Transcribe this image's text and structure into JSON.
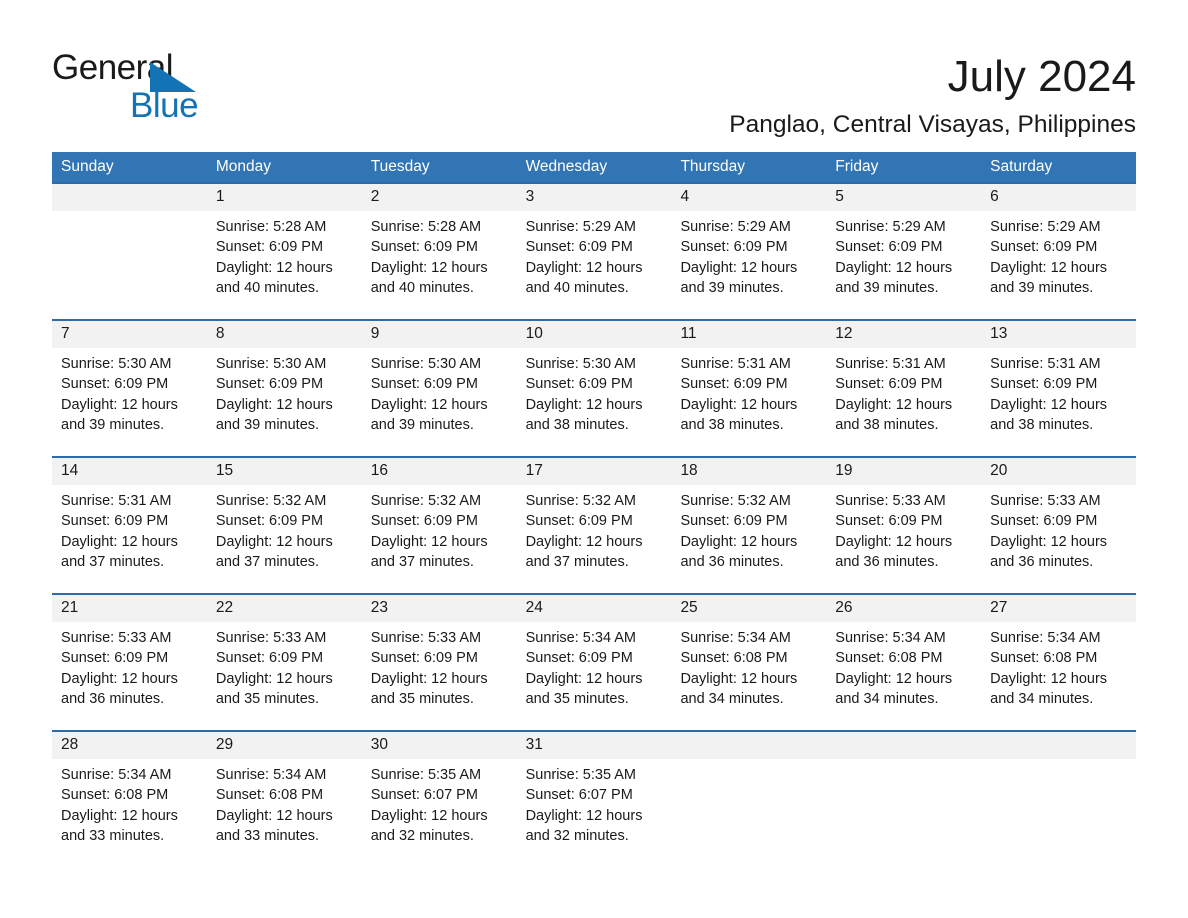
{
  "logo": {
    "word_one": "General",
    "word_two": "Blue",
    "triangle_color": "#1473b5",
    "text_color": "#1a1a1a"
  },
  "header": {
    "title": "July 2024",
    "location": "Panglao, Central Visayas, Philippines"
  },
  "calendar": {
    "header_bg": "#3275b4",
    "header_text_color": "#ffffff",
    "row_border_color": "#2d6ca8",
    "daynum_band_color": "#f2f2f2",
    "weekdays": [
      "Sunday",
      "Monday",
      "Tuesday",
      "Wednesday",
      "Thursday",
      "Friday",
      "Saturday"
    ],
    "weeks": [
      [
        {
          "day": "",
          "sunrise": "",
          "sunset": "",
          "daylight_line1": "",
          "daylight_line2": ""
        },
        {
          "day": "1",
          "sunrise": "Sunrise: 5:28 AM",
          "sunset": "Sunset: 6:09 PM",
          "daylight_line1": "Daylight: 12 hours",
          "daylight_line2": "and 40 minutes."
        },
        {
          "day": "2",
          "sunrise": "Sunrise: 5:28 AM",
          "sunset": "Sunset: 6:09 PM",
          "daylight_line1": "Daylight: 12 hours",
          "daylight_line2": "and 40 minutes."
        },
        {
          "day": "3",
          "sunrise": "Sunrise: 5:29 AM",
          "sunset": "Sunset: 6:09 PM",
          "daylight_line1": "Daylight: 12 hours",
          "daylight_line2": "and 40 minutes."
        },
        {
          "day": "4",
          "sunrise": "Sunrise: 5:29 AM",
          "sunset": "Sunset: 6:09 PM",
          "daylight_line1": "Daylight: 12 hours",
          "daylight_line2": "and 39 minutes."
        },
        {
          "day": "5",
          "sunrise": "Sunrise: 5:29 AM",
          "sunset": "Sunset: 6:09 PM",
          "daylight_line1": "Daylight: 12 hours",
          "daylight_line2": "and 39 minutes."
        },
        {
          "day": "6",
          "sunrise": "Sunrise: 5:29 AM",
          "sunset": "Sunset: 6:09 PM",
          "daylight_line1": "Daylight: 12 hours",
          "daylight_line2": "and 39 minutes."
        }
      ],
      [
        {
          "day": "7",
          "sunrise": "Sunrise: 5:30 AM",
          "sunset": "Sunset: 6:09 PM",
          "daylight_line1": "Daylight: 12 hours",
          "daylight_line2": "and 39 minutes."
        },
        {
          "day": "8",
          "sunrise": "Sunrise: 5:30 AM",
          "sunset": "Sunset: 6:09 PM",
          "daylight_line1": "Daylight: 12 hours",
          "daylight_line2": "and 39 minutes."
        },
        {
          "day": "9",
          "sunrise": "Sunrise: 5:30 AM",
          "sunset": "Sunset: 6:09 PM",
          "daylight_line1": "Daylight: 12 hours",
          "daylight_line2": "and 39 minutes."
        },
        {
          "day": "10",
          "sunrise": "Sunrise: 5:30 AM",
          "sunset": "Sunset: 6:09 PM",
          "daylight_line1": "Daylight: 12 hours",
          "daylight_line2": "and 38 minutes."
        },
        {
          "day": "11",
          "sunrise": "Sunrise: 5:31 AM",
          "sunset": "Sunset: 6:09 PM",
          "daylight_line1": "Daylight: 12 hours",
          "daylight_line2": "and 38 minutes."
        },
        {
          "day": "12",
          "sunrise": "Sunrise: 5:31 AM",
          "sunset": "Sunset: 6:09 PM",
          "daylight_line1": "Daylight: 12 hours",
          "daylight_line2": "and 38 minutes."
        },
        {
          "day": "13",
          "sunrise": "Sunrise: 5:31 AM",
          "sunset": "Sunset: 6:09 PM",
          "daylight_line1": "Daylight: 12 hours",
          "daylight_line2": "and 38 minutes."
        }
      ],
      [
        {
          "day": "14",
          "sunrise": "Sunrise: 5:31 AM",
          "sunset": "Sunset: 6:09 PM",
          "daylight_line1": "Daylight: 12 hours",
          "daylight_line2": "and 37 minutes."
        },
        {
          "day": "15",
          "sunrise": "Sunrise: 5:32 AM",
          "sunset": "Sunset: 6:09 PM",
          "daylight_line1": "Daylight: 12 hours",
          "daylight_line2": "and 37 minutes."
        },
        {
          "day": "16",
          "sunrise": "Sunrise: 5:32 AM",
          "sunset": "Sunset: 6:09 PM",
          "daylight_line1": "Daylight: 12 hours",
          "daylight_line2": "and 37 minutes."
        },
        {
          "day": "17",
          "sunrise": "Sunrise: 5:32 AM",
          "sunset": "Sunset: 6:09 PM",
          "daylight_line1": "Daylight: 12 hours",
          "daylight_line2": "and 37 minutes."
        },
        {
          "day": "18",
          "sunrise": "Sunrise: 5:32 AM",
          "sunset": "Sunset: 6:09 PM",
          "daylight_line1": "Daylight: 12 hours",
          "daylight_line2": "and 36 minutes."
        },
        {
          "day": "19",
          "sunrise": "Sunrise: 5:33 AM",
          "sunset": "Sunset: 6:09 PM",
          "daylight_line1": "Daylight: 12 hours",
          "daylight_line2": "and 36 minutes."
        },
        {
          "day": "20",
          "sunrise": "Sunrise: 5:33 AM",
          "sunset": "Sunset: 6:09 PM",
          "daylight_line1": "Daylight: 12 hours",
          "daylight_line2": "and 36 minutes."
        }
      ],
      [
        {
          "day": "21",
          "sunrise": "Sunrise: 5:33 AM",
          "sunset": "Sunset: 6:09 PM",
          "daylight_line1": "Daylight: 12 hours",
          "daylight_line2": "and 36 minutes."
        },
        {
          "day": "22",
          "sunrise": "Sunrise: 5:33 AM",
          "sunset": "Sunset: 6:09 PM",
          "daylight_line1": "Daylight: 12 hours",
          "daylight_line2": "and 35 minutes."
        },
        {
          "day": "23",
          "sunrise": "Sunrise: 5:33 AM",
          "sunset": "Sunset: 6:09 PM",
          "daylight_line1": "Daylight: 12 hours",
          "daylight_line2": "and 35 minutes."
        },
        {
          "day": "24",
          "sunrise": "Sunrise: 5:34 AM",
          "sunset": "Sunset: 6:09 PM",
          "daylight_line1": "Daylight: 12 hours",
          "daylight_line2": "and 35 minutes."
        },
        {
          "day": "25",
          "sunrise": "Sunrise: 5:34 AM",
          "sunset": "Sunset: 6:08 PM",
          "daylight_line1": "Daylight: 12 hours",
          "daylight_line2": "and 34 minutes."
        },
        {
          "day": "26",
          "sunrise": "Sunrise: 5:34 AM",
          "sunset": "Sunset: 6:08 PM",
          "daylight_line1": "Daylight: 12 hours",
          "daylight_line2": "and 34 minutes."
        },
        {
          "day": "27",
          "sunrise": "Sunrise: 5:34 AM",
          "sunset": "Sunset: 6:08 PM",
          "daylight_line1": "Daylight: 12 hours",
          "daylight_line2": "and 34 minutes."
        }
      ],
      [
        {
          "day": "28",
          "sunrise": "Sunrise: 5:34 AM",
          "sunset": "Sunset: 6:08 PM",
          "daylight_line1": "Daylight: 12 hours",
          "daylight_line2": "and 33 minutes."
        },
        {
          "day": "29",
          "sunrise": "Sunrise: 5:34 AM",
          "sunset": "Sunset: 6:08 PM",
          "daylight_line1": "Daylight: 12 hours",
          "daylight_line2": "and 33 minutes."
        },
        {
          "day": "30",
          "sunrise": "Sunrise: 5:35 AM",
          "sunset": "Sunset: 6:07 PM",
          "daylight_line1": "Daylight: 12 hours",
          "daylight_line2": "and 32 minutes."
        },
        {
          "day": "31",
          "sunrise": "Sunrise: 5:35 AM",
          "sunset": "Sunset: 6:07 PM",
          "daylight_line1": "Daylight: 12 hours",
          "daylight_line2": "and 32 minutes."
        },
        {
          "day": "",
          "sunrise": "",
          "sunset": "",
          "daylight_line1": "",
          "daylight_line2": ""
        },
        {
          "day": "",
          "sunrise": "",
          "sunset": "",
          "daylight_line1": "",
          "daylight_line2": ""
        },
        {
          "day": "",
          "sunrise": "",
          "sunset": "",
          "daylight_line1": "",
          "daylight_line2": ""
        }
      ]
    ]
  }
}
